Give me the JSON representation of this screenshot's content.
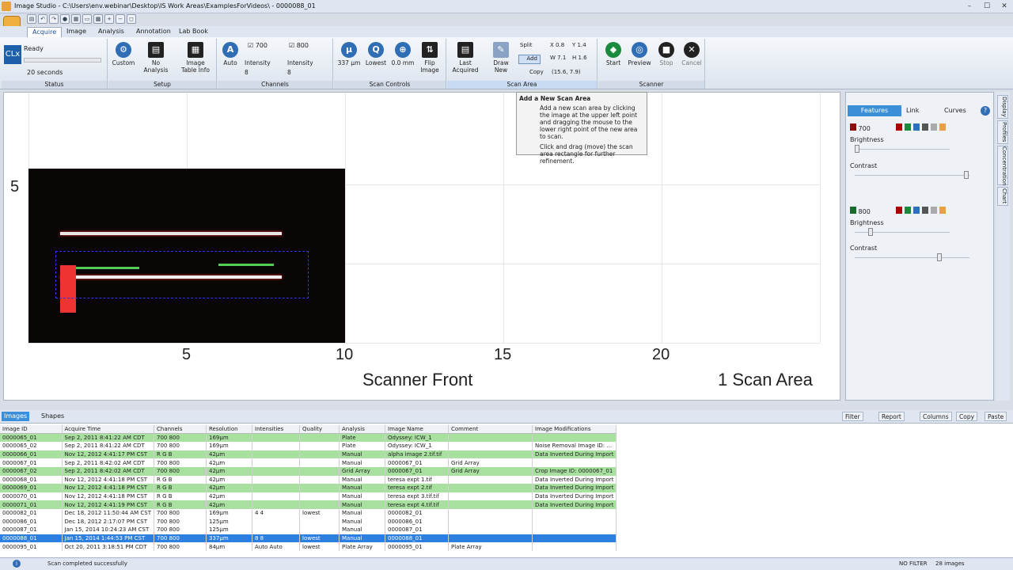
{
  "window": {
    "title": "Image Studio - C:\\Users\\env.webinar\\Desktop\\IS Work Areas\\ExamplesForVideos\\ - 0000088_01"
  },
  "tabs": [
    "Acquire",
    "Image",
    "Analysis",
    "Annotation",
    "Lab Book"
  ],
  "status": {
    "text": "Ready",
    "time": "20 seconds",
    "logo": "CLx",
    "label": "Status"
  },
  "setup": {
    "label": "Setup",
    "custom": "Custom",
    "no_analysis": "No Analysis",
    "table_info": "Image Table Info"
  },
  "channels": {
    "label": "Channels",
    "auto": "Auto",
    "c1": "700",
    "c2": "800",
    "intensity": "Intensity",
    "i1": "8",
    "i2": "8"
  },
  "scan_controls": {
    "label": "Scan Controls",
    "res": "337 µm",
    "quality": "Lowest",
    "focus": "0.0 mm",
    "flip": "Flip Image"
  },
  "scan_area": {
    "label": "Scan Area",
    "last": "Last Acquired",
    "draw": "Draw New",
    "split": "Split",
    "add": "Add",
    "copy": "Copy",
    "x": "0.8",
    "y": "1.4",
    "w": "7.1",
    "h": "1.6",
    "coords": "(15.6, 7.9)",
    "x_label": "X",
    "y_label": "Y",
    "w_label": "W",
    "h_label": "H"
  },
  "scanner": {
    "label": "Scanner",
    "start": "Start",
    "preview": "Preview",
    "stop": "Stop",
    "cancel": "Cancel"
  },
  "canvas": {
    "y5": "5",
    "x5": "5",
    "x10": "10",
    "x15": "15",
    "x20": "20",
    "front": "Scanner Front",
    "areas": "1 Scan Area"
  },
  "tooltip": {
    "title": "Add a New Scan Area",
    "p1": "Add a new scan area by clicking the image at the upper left point and dragging the mouse to the lower right point of the new area to scan.",
    "p2": "Click and drag (move) the scan area rectangle for further refinement."
  },
  "panel": {
    "features": "Features",
    "link": "Link",
    "curves": "Curves",
    "ch700": "700",
    "ch800": "800",
    "brightness": "Brightness",
    "contrast": "Contrast"
  },
  "sidetabs": [
    "Display",
    "Profiles",
    "Concentration",
    "Chart"
  ],
  "bottom": {
    "images": "Images",
    "shapes": "Shapes",
    "filter": "Filter",
    "report": "Report",
    "columns": "Columns",
    "copy": "Copy",
    "paste": "Paste"
  },
  "table": {
    "headers": [
      "Image ID",
      "Acquire Time",
      "Channels",
      "Resolution",
      "Intensities",
      "Quality",
      "Analysis",
      "Image Name",
      "Comment",
      "Image Modifications"
    ],
    "rows": [
      [
        "0000065_01",
        "Sep 2, 2011 8:41:22 AM CDT",
        "700 800",
        "169µm",
        "",
        "",
        "Plate",
        "Odyssey: ICW_1",
        "",
        ""
      ],
      [
        "0000065_02",
        "Sep 2, 2011 8:41:22 AM CDT",
        "700 800",
        "169µm",
        "",
        "",
        "Plate",
        "Odyssey: ICW_1",
        "",
        "Noise Removal Image ID: ..."
      ],
      [
        "0000066_01",
        "Nov 12, 2012 4:41:17 PM CST",
        "R G B",
        "42µm",
        "",
        "",
        "Manual",
        "alpha image 2.tif.tif",
        "",
        "Data Inverted During Import"
      ],
      [
        "0000067_01",
        "Sep 2, 2011 8:42:02 AM CDT",
        "700 800",
        "42µm",
        "",
        "",
        "Manual",
        "0000067_01",
        "Grid Array",
        ""
      ],
      [
        "0000067_02",
        "Sep 2, 2011 8:42:02 AM CDT",
        "700 800",
        "42µm",
        "",
        "",
        "Grid Array",
        "0000067_01",
        "Grid Array",
        "Crop Image ID: 0000067_01"
      ],
      [
        "0000068_01",
        "Nov 12, 2012 4:41:18 PM CST",
        "R G B",
        "42µm",
        "",
        "",
        "Manual",
        "teresa expt 1.tif",
        "",
        "Data Inverted During Import"
      ],
      [
        "0000069_01",
        "Nov 12, 2012 4:41:18 PM CST",
        "R G B",
        "42µm",
        "",
        "",
        "Manual",
        "teresa expt 2.tif",
        "",
        "Data Inverted During Import"
      ],
      [
        "0000070_01",
        "Nov 12, 2012 4:41:18 PM CST",
        "R G B",
        "42µm",
        "",
        "",
        "Manual",
        "teresa expt 3.tif.tif",
        "",
        "Data Inverted During Import"
      ],
      [
        "0000071_01",
        "Nov 12, 2012 4:41:19 PM CST",
        "R G B",
        "42µm",
        "",
        "",
        "Manual",
        "teresa expt 4.tif.tif",
        "",
        "Data Inverted During Import"
      ],
      [
        "0000082_01",
        "Dec 18, 2012 11:50:44 AM CST",
        "700 800",
        "169µm",
        "4 4",
        "lowest",
        "Manual",
        "0000082_01",
        "",
        ""
      ],
      [
        "0000086_01",
        "Dec 18, 2012 2:17:07 PM CST",
        "700 800",
        "125µm",
        "",
        "",
        "Manual",
        "0000086_01",
        "",
        ""
      ],
      [
        "0000087_01",
        "Jan 15, 2014 10:24:23 AM CST",
        "700 800",
        "125µm",
        "",
        "",
        "Manual",
        "0000087_01",
        "",
        ""
      ],
      [
        "0000088_01",
        "Jan 15, 2014 1:44:53 PM CST",
        "700 800",
        "337µm",
        "8 8",
        "lowest",
        "Manual",
        "0000088_01",
        "",
        ""
      ],
      [
        "0000095_01",
        "Oct 20, 2011 3:18:51 PM CDT",
        "700 800",
        "84µm",
        "Auto Auto",
        "lowest",
        "Plate Array",
        "0000095_01",
        "Plate Array",
        ""
      ]
    ],
    "row_styles": [
      "g",
      "w",
      "g",
      "w",
      "g",
      "w",
      "g",
      "w",
      "g",
      "w",
      "w",
      "w",
      "sel",
      "w"
    ]
  },
  "statusbar": {
    "message": "Scan completed successfully",
    "filter": "NO FILTER",
    "count": "28 images"
  }
}
